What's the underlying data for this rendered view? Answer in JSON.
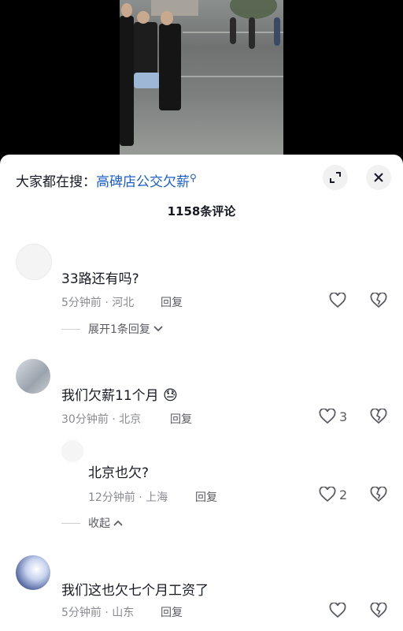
{
  "search": {
    "prefix": "大家都在搜：",
    "keyword": "高碑店公交欠薪",
    "icon": "search-icon"
  },
  "comments_header": {
    "count_label": "1158条评论"
  },
  "comments": [
    {
      "text": "33路还有吗?",
      "time_location": "5分钟前 · 河北",
      "reply_label": "回复",
      "likes": "",
      "expand_label": "展开1条回复"
    },
    {
      "text": "我们欠薪11个月",
      "emoji": "😓",
      "time_location": "30分钟前 · 北京",
      "reply_label": "回复",
      "likes": "3",
      "replies": [
        {
          "text": "北京也欠?",
          "time_location": "12分钟前 · 上海",
          "reply_label": "回复",
          "likes": "2"
        }
      ],
      "collapse_label": "收起"
    },
    {
      "text": "我们这也欠七个月工资了",
      "time_location": "5分钟前 · 山东",
      "reply_label": "回复",
      "likes": ""
    }
  ],
  "colors": {
    "keyword_blue": "#1a5ec9",
    "meta_gray": "#8a8b91",
    "text_dark": "#161823"
  }
}
